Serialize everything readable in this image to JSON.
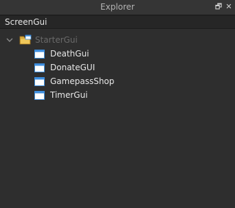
{
  "panel": {
    "title": "Explorer",
    "restore_icon": "restore-window-icon",
    "close_icon": "close-icon",
    "restore_glyph": "🗗",
    "close_glyph": "✕"
  },
  "filter": {
    "value": "ScreenGui"
  },
  "tree": {
    "root": {
      "label": "StarterGui",
      "icon": "folder-icon",
      "expanded": true
    },
    "children": [
      {
        "label": "DeathGui",
        "icon": "screen-gui-icon"
      },
      {
        "label": "DonateGUI",
        "icon": "screen-gui-icon"
      },
      {
        "label": "GamepassShop",
        "icon": "screen-gui-icon"
      },
      {
        "label": "TimerGui",
        "icon": "screen-gui-icon"
      }
    ]
  },
  "colors": {
    "background": "#2e2e2e",
    "titlebar": "#353535",
    "filterbar": "#262626",
    "gui_icon_fill": "#ffffff",
    "gui_icon_bar": "#3d8ede",
    "folder": "#d9a93c"
  }
}
